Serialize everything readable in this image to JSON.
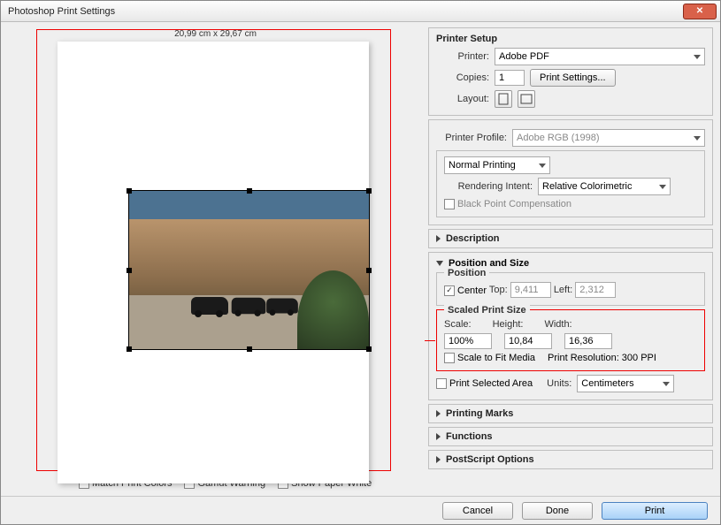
{
  "window": {
    "title": "Photoshop Print Settings"
  },
  "preview": {
    "paper_dimensions": "20,99 cm x 29,67 cm"
  },
  "leftChecks": {
    "match": "Match Print Colors",
    "gamut": "Gamut Warning",
    "paperwhite": "Show Paper White"
  },
  "printerSetup": {
    "heading": "Printer Setup",
    "printer_label": "Printer:",
    "printer_value": "Adobe PDF",
    "copies_label": "Copies:",
    "copies_value": "1",
    "print_settings_btn": "Print Settings...",
    "layout_label": "Layout:"
  },
  "colorMgmt": {
    "profile_label": "Printer Profile:",
    "profile_value": "Adobe RGB (1998)",
    "mode_value": "Normal Printing",
    "intent_label": "Rendering Intent:",
    "intent_value": "Relative Colorimetric",
    "blackpoint": "Black Point Compensation"
  },
  "description_heading": "Description",
  "posSize": {
    "heading": "Position and Size",
    "position_legend": "Position",
    "center_label": "Center",
    "top_label": "Top:",
    "top_value": "9,411",
    "left_label": "Left:",
    "left_value": "2,312",
    "scaled_legend": "Scaled Print Size",
    "scale_label": "Scale:",
    "scale_value": "100%",
    "height_label": "Height:",
    "height_value": "10,84",
    "width_label": "Width:",
    "width_value": "16,36",
    "fit_label": "Scale to Fit Media",
    "res_label": "Print Resolution: 300 PPI",
    "selarea_label": "Print Selected Area",
    "units_label": "Units:",
    "units_value": "Centimeters"
  },
  "marks_heading": "Printing Marks",
  "functions_heading": "Functions",
  "postscript_heading": "PostScript Options",
  "footer": {
    "cancel": "Cancel",
    "done": "Done",
    "print": "Print"
  }
}
